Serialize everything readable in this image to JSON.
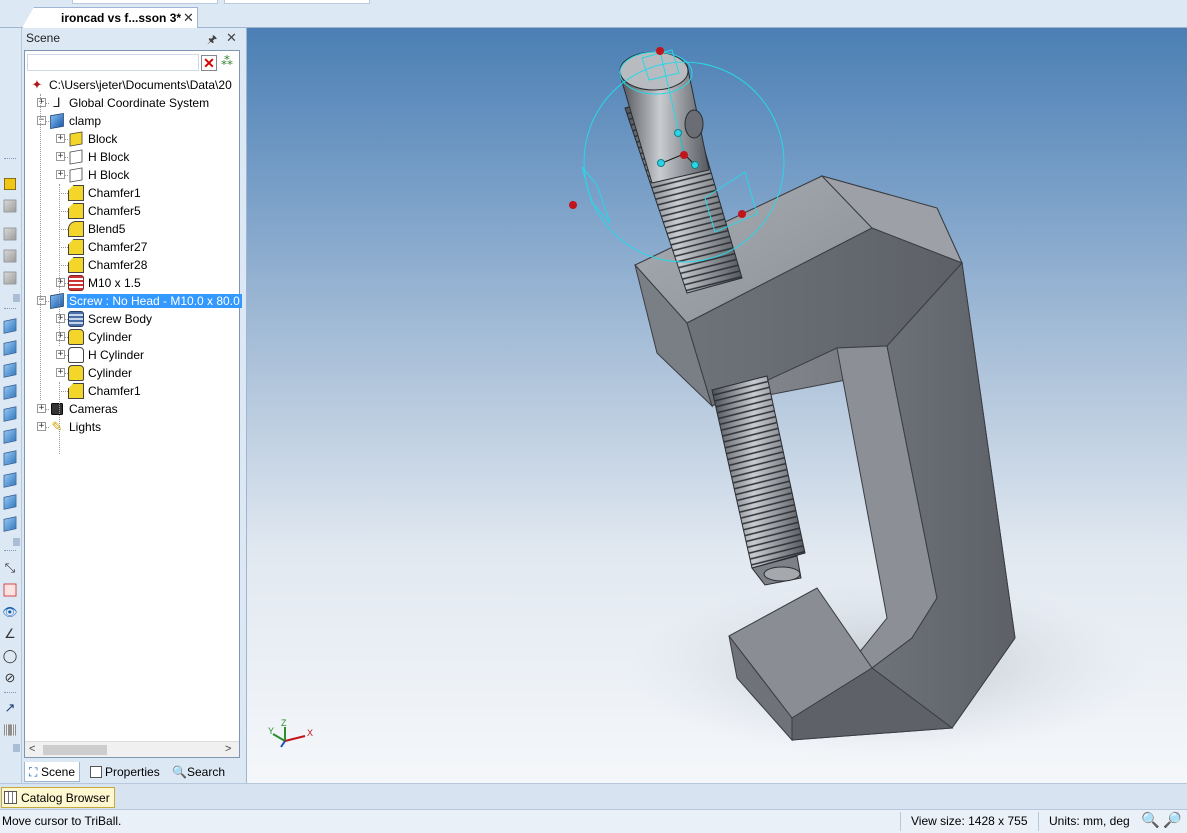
{
  "document_tab": {
    "label": "ironcad vs f...sson 3*",
    "close": "✕"
  },
  "scene_panel": {
    "title": "Scene",
    "pin": "🖈",
    "close": "✕",
    "clear_filter": "✕",
    "tree": [
      {
        "label": "C:\\Users\\jeter\\Documents\\Data\\20",
        "icon": "root-icon",
        "level": 0,
        "expand": ""
      },
      {
        "label": "Global Coordinate System",
        "icon": "coordinate-system-icon",
        "level": 1,
        "expand": "+"
      },
      {
        "label": "clamp",
        "icon": "part-icon",
        "level": 1,
        "expand": "−"
      },
      {
        "label": "Block",
        "icon": "block-icon",
        "level": 2,
        "expand": "+"
      },
      {
        "label": "H Block",
        "icon": "hole-block-icon",
        "level": 2,
        "expand": "+"
      },
      {
        "label": "H Block",
        "icon": "hole-block-icon",
        "level": 2,
        "expand": "+"
      },
      {
        "label": "Chamfer1",
        "icon": "chamfer-icon",
        "level": 2,
        "expand": ""
      },
      {
        "label": "Chamfer5",
        "icon": "chamfer-icon",
        "level": 2,
        "expand": ""
      },
      {
        "label": "Blend5",
        "icon": "blend-icon",
        "level": 2,
        "expand": ""
      },
      {
        "label": "Chamfer27",
        "icon": "chamfer-icon",
        "level": 2,
        "expand": ""
      },
      {
        "label": "Chamfer28",
        "icon": "chamfer-icon",
        "level": 2,
        "expand": ""
      },
      {
        "label": "M10 x 1.5",
        "icon": "thread-icon",
        "level": 2,
        "expand": "+"
      },
      {
        "label": "Screw : No Head - M10.0 x 80.0",
        "icon": "part-icon",
        "level": 1,
        "expand": "−",
        "selected": true
      },
      {
        "label": "Screw Body",
        "icon": "screw-body-icon",
        "level": 2,
        "expand": "+"
      },
      {
        "label": "Cylinder",
        "icon": "cylinder-icon",
        "level": 2,
        "expand": "+"
      },
      {
        "label": "H Cylinder",
        "icon": "hole-cylinder-icon",
        "level": 2,
        "expand": "+"
      },
      {
        "label": "Cylinder",
        "icon": "cylinder-icon",
        "level": 2,
        "expand": "+"
      },
      {
        "label": "Chamfer1",
        "icon": "chamfer-icon",
        "level": 2,
        "expand": ""
      },
      {
        "label": "Cameras",
        "icon": "camera-icon",
        "level": 1,
        "expand": "+"
      },
      {
        "label": "Lights",
        "icon": "light-icon",
        "level": 1,
        "expand": "+"
      }
    ],
    "scroll_left": "<",
    "scroll_right": ">",
    "tabs": [
      {
        "label": "Scene",
        "icon": "scene-icon",
        "active": true
      },
      {
        "label": "Properties",
        "icon": "properties-icon",
        "active": false
      },
      {
        "label": "Search",
        "icon": "search-icon",
        "active": false
      }
    ]
  },
  "viewport": {
    "axis_labels": {
      "x": "X",
      "y": "Y",
      "z": "Z"
    },
    "selection_color": "#2ad6e6",
    "handle_color": "#c0151b"
  },
  "catalog_bar": {
    "label": "Catalog Browser"
  },
  "status": {
    "message": "Move cursor to TriBall.",
    "view_size": "View size: 1428 x 755",
    "units": "Units: mm, deg"
  },
  "colors": {
    "accent_selection": "#3399ff",
    "part_gray": "#7b7f86",
    "feature_yellow": "#f4d62a"
  }
}
